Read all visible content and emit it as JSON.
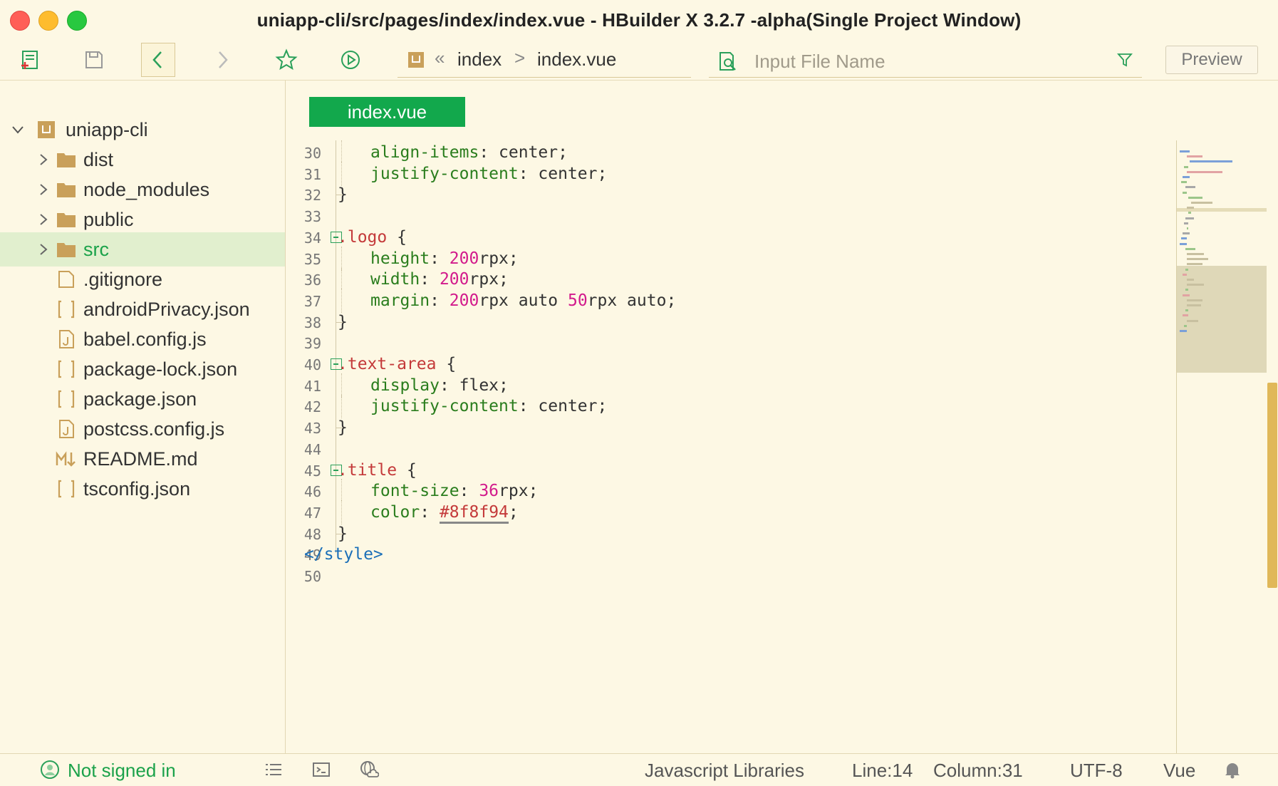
{
  "window": {
    "title": "uniapp-cli/src/pages/index/index.vue - HBuilder X 3.2.7 -alpha(Single Project Window)"
  },
  "toolbar": {
    "breadcrumb": {
      "sep_double": "«",
      "items": [
        "index",
        "index.vue"
      ],
      "sep_single": ">"
    },
    "search": {
      "placeholder": "Input File Name",
      "value": ""
    },
    "preview_label": "Preview"
  },
  "sidebar": {
    "project": "uniapp-cli",
    "items": [
      {
        "label": "dist",
        "type": "folder"
      },
      {
        "label": "node_modules",
        "type": "folder"
      },
      {
        "label": "public",
        "type": "folder"
      },
      {
        "label": "src",
        "type": "folder",
        "selected": true
      },
      {
        "label": ".gitignore",
        "type": "file"
      },
      {
        "label": "androidPrivacy.json",
        "type": "json"
      },
      {
        "label": "babel.config.js",
        "type": "js"
      },
      {
        "label": "package-lock.json",
        "type": "json"
      },
      {
        "label": "package.json",
        "type": "json"
      },
      {
        "label": "postcss.config.js",
        "type": "js"
      },
      {
        "label": "README.md",
        "type": "md"
      },
      {
        "label": "tsconfig.json",
        "type": "json"
      }
    ]
  },
  "editor": {
    "tab": "index.vue",
    "lines": [
      {
        "n": "30",
        "indent": 2,
        "tokens": [
          [
            "prop",
            "align-items"
          ],
          [
            "punc",
            ": "
          ],
          [
            "val",
            "center"
          ],
          [
            "punc",
            ";"
          ]
        ]
      },
      {
        "n": "31",
        "indent": 2,
        "tokens": [
          [
            "prop",
            "justify-content"
          ],
          [
            "punc",
            ": "
          ],
          [
            "val",
            "center"
          ],
          [
            "punc",
            ";"
          ]
        ]
      },
      {
        "n": "32",
        "indent": 1,
        "tokens": [
          [
            "punc",
            "}"
          ]
        ]
      },
      {
        "n": "33",
        "indent": 0,
        "tokens": []
      },
      {
        "n": "34",
        "indent": 1,
        "fold": true,
        "tokens": [
          [
            "sel",
            ".logo"
          ],
          [
            "punc",
            " {"
          ]
        ]
      },
      {
        "n": "35",
        "indent": 2,
        "tokens": [
          [
            "prop",
            "height"
          ],
          [
            "punc",
            ": "
          ],
          [
            "num",
            "200"
          ],
          [
            "val",
            "rpx"
          ],
          [
            "punc",
            ";"
          ]
        ]
      },
      {
        "n": "36",
        "indent": 2,
        "tokens": [
          [
            "prop",
            "width"
          ],
          [
            "punc",
            ": "
          ],
          [
            "num",
            "200"
          ],
          [
            "val",
            "rpx"
          ],
          [
            "punc",
            ";"
          ]
        ]
      },
      {
        "n": "37",
        "indent": 2,
        "tokens": [
          [
            "prop",
            "margin"
          ],
          [
            "punc",
            ": "
          ],
          [
            "num",
            "200"
          ],
          [
            "val",
            "rpx auto "
          ],
          [
            "num",
            "50"
          ],
          [
            "val",
            "rpx auto"
          ],
          [
            "punc",
            ";"
          ]
        ]
      },
      {
        "n": "38",
        "indent": 1,
        "tokens": [
          [
            "punc",
            "}"
          ]
        ]
      },
      {
        "n": "39",
        "indent": 0,
        "tokens": []
      },
      {
        "n": "40",
        "indent": 1,
        "fold": true,
        "tokens": [
          [
            "sel",
            ".text-area"
          ],
          [
            "punc",
            " {"
          ]
        ]
      },
      {
        "n": "41",
        "indent": 2,
        "tokens": [
          [
            "prop",
            "display"
          ],
          [
            "punc",
            ": "
          ],
          [
            "val",
            "flex"
          ],
          [
            "punc",
            ";"
          ]
        ]
      },
      {
        "n": "42",
        "indent": 2,
        "tokens": [
          [
            "prop",
            "justify-content"
          ],
          [
            "punc",
            ": "
          ],
          [
            "val",
            "center"
          ],
          [
            "punc",
            ";"
          ]
        ]
      },
      {
        "n": "43",
        "indent": 1,
        "tokens": [
          [
            "punc",
            "}"
          ]
        ]
      },
      {
        "n": "44",
        "indent": 0,
        "tokens": []
      },
      {
        "n": "45",
        "indent": 1,
        "fold": true,
        "tokens": [
          [
            "sel",
            ".title"
          ],
          [
            "punc",
            " {"
          ]
        ]
      },
      {
        "n": "46",
        "indent": 2,
        "tokens": [
          [
            "prop",
            "font-size"
          ],
          [
            "punc",
            ": "
          ],
          [
            "num",
            "36"
          ],
          [
            "val",
            "rpx"
          ],
          [
            "punc",
            ";"
          ]
        ]
      },
      {
        "n": "47",
        "indent": 2,
        "tokens": [
          [
            "prop",
            "color"
          ],
          [
            "punc",
            ": "
          ],
          [
            "hex",
            "#8f8f94"
          ],
          [
            "punc",
            ";"
          ]
        ]
      },
      {
        "n": "48",
        "indent": 1,
        "tokens": [
          [
            "punc",
            "}"
          ]
        ]
      },
      {
        "n": "49",
        "indent": 0,
        "tokens": [
          [
            "tag",
            "</style>"
          ]
        ]
      },
      {
        "n": "50",
        "indent": 0,
        "tokens": []
      }
    ]
  },
  "statusbar": {
    "user": "Not signed in",
    "libraries": "Javascript Libraries",
    "line": "Line:14",
    "column": "Column:31",
    "encoding": "UTF-8",
    "language": "Vue"
  },
  "colors": {
    "accent": "#12a84c",
    "background": "#fdf8e4",
    "selection": "#e1efce",
    "scrollbar": "#e0b859"
  }
}
